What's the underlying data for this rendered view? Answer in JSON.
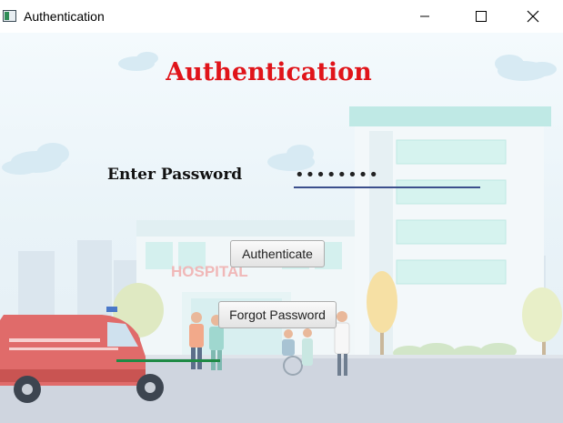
{
  "window": {
    "title": "Authentication",
    "app_icon": "java-window-icon",
    "controls": {
      "minimize": "minimize-icon",
      "maximize": "maximize-icon",
      "close": "close-icon"
    }
  },
  "form": {
    "heading": "Authentication",
    "password_label": "Enter Password",
    "password_value": "••••••••",
    "authenticate_label": "Authenticate",
    "forgot_label": "Forgot Password"
  },
  "background": {
    "sign_text": "HOSPITAL"
  },
  "colors": {
    "heading": "#e0141a",
    "field_underline": "#3c4f8c",
    "accent_line": "#1f8a45"
  }
}
